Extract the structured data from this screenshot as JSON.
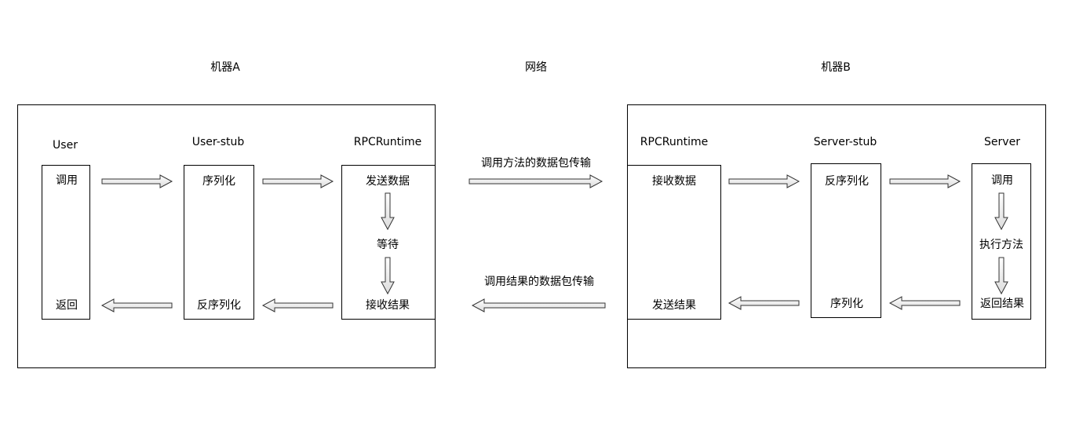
{
  "headers": {
    "machine_a": "机器A",
    "network": "网络",
    "machine_b": "机器B"
  },
  "machine_a": {
    "user": {
      "title": "User",
      "call": "调用",
      "return": "返回"
    },
    "user_stub": {
      "title": "User-stub",
      "serialize": "序列化",
      "deserialize": "反序列化"
    },
    "rpc_runtime": {
      "title": "RPCRuntime",
      "send": "发送数据",
      "wait": "等待",
      "receive": "接收结果"
    }
  },
  "network": {
    "request": "调用方法的数据包传输",
    "response": "调用结果的数据包传输"
  },
  "machine_b": {
    "rpc_runtime": {
      "title": "RPCRuntime",
      "receive": "接收数据",
      "send": "发送结果"
    },
    "server_stub": {
      "title": "Server-stub",
      "deserialize": "反序列化",
      "serialize": "序列化"
    },
    "server": {
      "title": "Server",
      "call": "调用",
      "execute": "执行方法",
      "return": "返回结果"
    }
  }
}
